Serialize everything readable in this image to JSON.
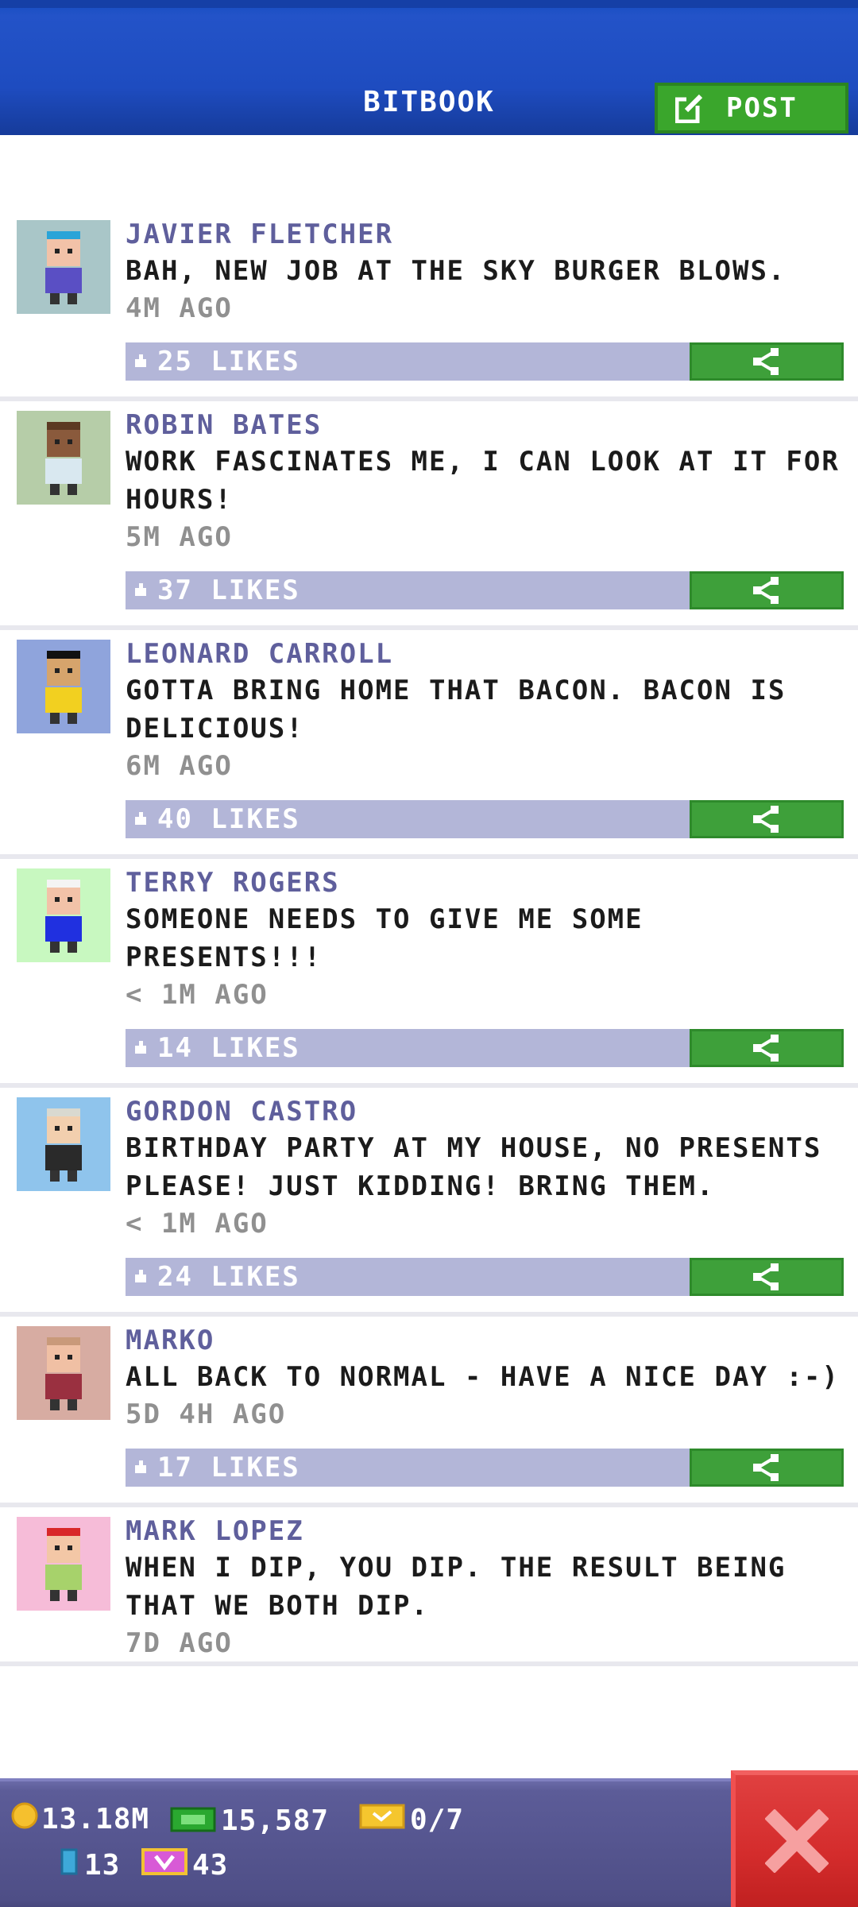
{
  "header": {
    "title": "BITBOOK",
    "post_label": "POST",
    "post_icon": "compose-icon"
  },
  "posts": [
    {
      "name": "JAVIER FLETCHER",
      "text": "BAH, NEW JOB AT THE SKY BURGER BLOWS.",
      "time": "4M AGO",
      "likes": "25 LIKES",
      "avatar_bg": "#a9c6c8"
    },
    {
      "name": "ROBIN BATES",
      "text": "WORK FASCINATES ME, I CAN LOOK AT IT FOR HOURS!",
      "time": "5M AGO",
      "likes": "37 LIKES",
      "avatar_bg": "#b6cda8"
    },
    {
      "name": "LEONARD CARROLL",
      "text": "GOTTA BRING HOME THAT BACON. BACON IS DELICIOUS!",
      "time": "6M AGO",
      "likes": "40 LIKES",
      "avatar_bg": "#8fa4dc"
    },
    {
      "name": "TERRY ROGERS",
      "text": "SOMEONE NEEDS TO GIVE ME SOME PRESENTS!!!",
      "time": "< 1M AGO",
      "likes": "14 LIKES",
      "avatar_bg": "#c8f8c0"
    },
    {
      "name": "GORDON CASTRO",
      "text": "BIRTHDAY PARTY AT MY HOUSE, NO PRESENTS PLEASE! JUST KIDDING! BRING THEM.",
      "time": "< 1M AGO",
      "likes": "24 LIKES",
      "avatar_bg": "#8fc4ec"
    },
    {
      "name": "MARKO",
      "text": "ALL BACK TO NORMAL - HAVE A NICE DAY :-)",
      "time": "5D 4H AGO",
      "likes": "17 LIKES",
      "avatar_bg": "#d7aca2"
    },
    {
      "name": "MARK LOPEZ",
      "text": "WHEN I DIP, YOU DIP. THE RESULT BEING THAT WE BOTH DIP.",
      "time": "7D AGO",
      "likes": "",
      "avatar_bg": "#f6bcd8"
    }
  ],
  "status": {
    "coins": "13.18M",
    "cash": "15,587",
    "tickets": "0/7",
    "gems": "13",
    "bux": "43"
  },
  "colors": {
    "header_blue": "#1e4cc0",
    "post_green": "#3aa62c",
    "like_bar": "#b3b6d8",
    "name_purple": "#5f5f9c",
    "close_red": "#d42c2c"
  }
}
